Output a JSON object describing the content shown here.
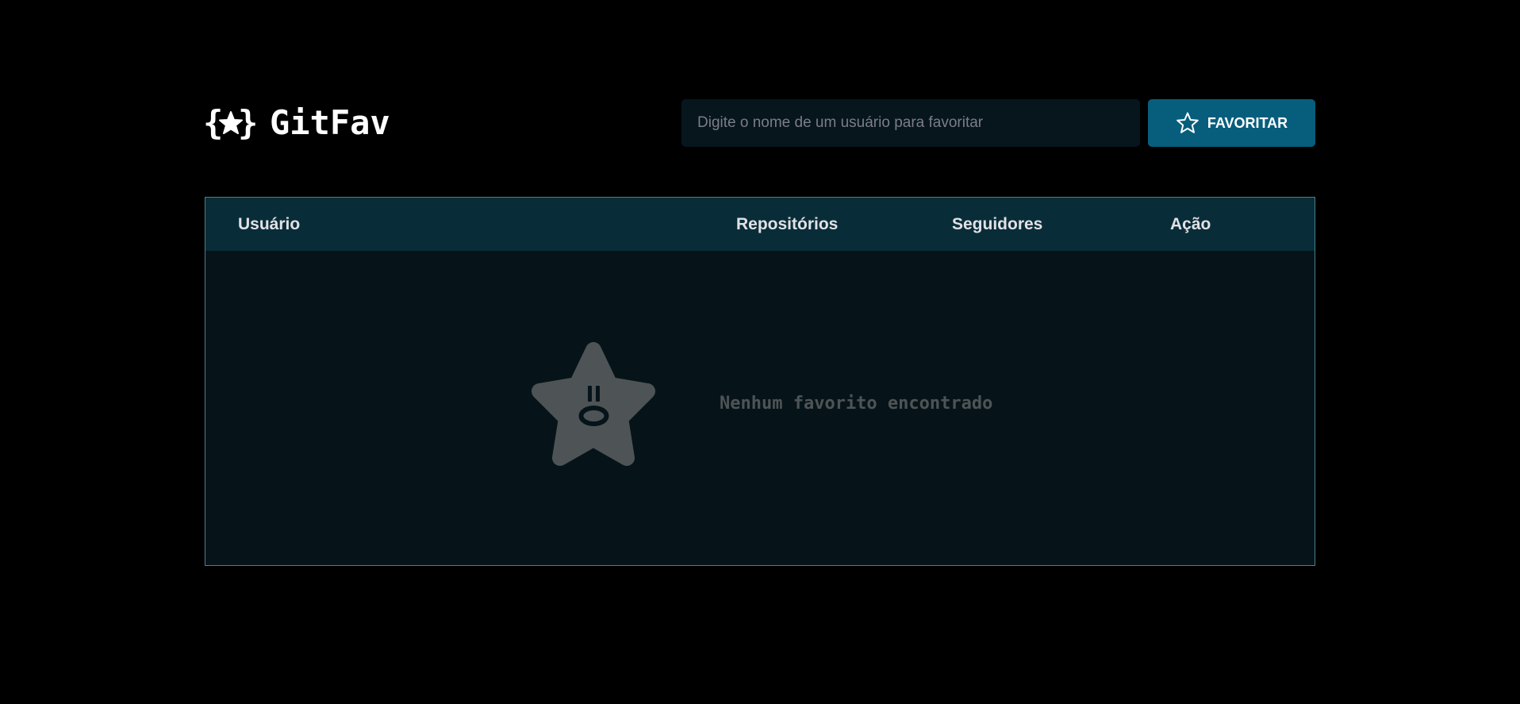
{
  "app": {
    "name": "GitFav"
  },
  "search": {
    "placeholder": "Digite o nome de um usuário para favoritar",
    "value": ""
  },
  "favorite_button": {
    "label": "FAVORITAR",
    "icon": "star-outline-icon"
  },
  "table": {
    "columns": [
      "Usuário",
      "Repositórios",
      "Seguidores",
      "Ação"
    ],
    "rows": []
  },
  "empty_state": {
    "icon": "surprised-star-icon",
    "message": "Nenhum favorito encontrado"
  },
  "colors": {
    "background": "#000000",
    "accent": "#065e7c",
    "table_header": "#092d38",
    "table_body": "#06141a",
    "table_border": "#4a808c",
    "empty_icon": "#4e5455"
  }
}
